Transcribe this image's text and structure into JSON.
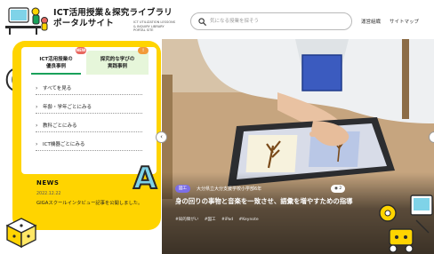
{
  "header": {
    "title_line1": "ICT活用授業＆探究ライブラリ",
    "title_line2": "ポータルサイト",
    "subtitle": "ICT UTILIZATION LESSONS & INQUIRY LIBRARY PORTAL SITE",
    "search_placeholder": "気になる授業を探そう",
    "nav": [
      "運営組織",
      "サイトマップ"
    ]
  },
  "tabs": [
    {
      "line1": "ICT活用授業の",
      "line2": "優良事例",
      "badge": "NEW",
      "color": "#e8675f"
    },
    {
      "line1": "探究的な学びの",
      "line2": "実践事例",
      "badge": "!",
      "color": "#f29a3a"
    }
  ],
  "menu": [
    {
      "label": "すべてを見る"
    },
    {
      "label": "年齢・学年ごとにみる"
    },
    {
      "label": "教科ごとにみる"
    },
    {
      "label": "ICT機器ごとにみる"
    }
  ],
  "news": {
    "heading": "NEWS",
    "date": "2022.12.22",
    "text": "GIGAスクールインタビュー記事を公開しました。"
  },
  "hero": {
    "category": "図工",
    "school": "大分県立大分支援学校小学部6年",
    "count": "2",
    "title": "身の回りの事物と音楽を一致させ、語彙を増やすための指導",
    "tags": [
      "#知的障がい",
      "#図工",
      "#iPad",
      "#Keynote"
    ],
    "arrow_left": "‹"
  },
  "deco": {
    "letter_c": "C",
    "letter_a": "A"
  },
  "colors": {
    "accent_yellow": "#ffd400",
    "green": "#19a15a",
    "purple": "#7c6ee6"
  }
}
